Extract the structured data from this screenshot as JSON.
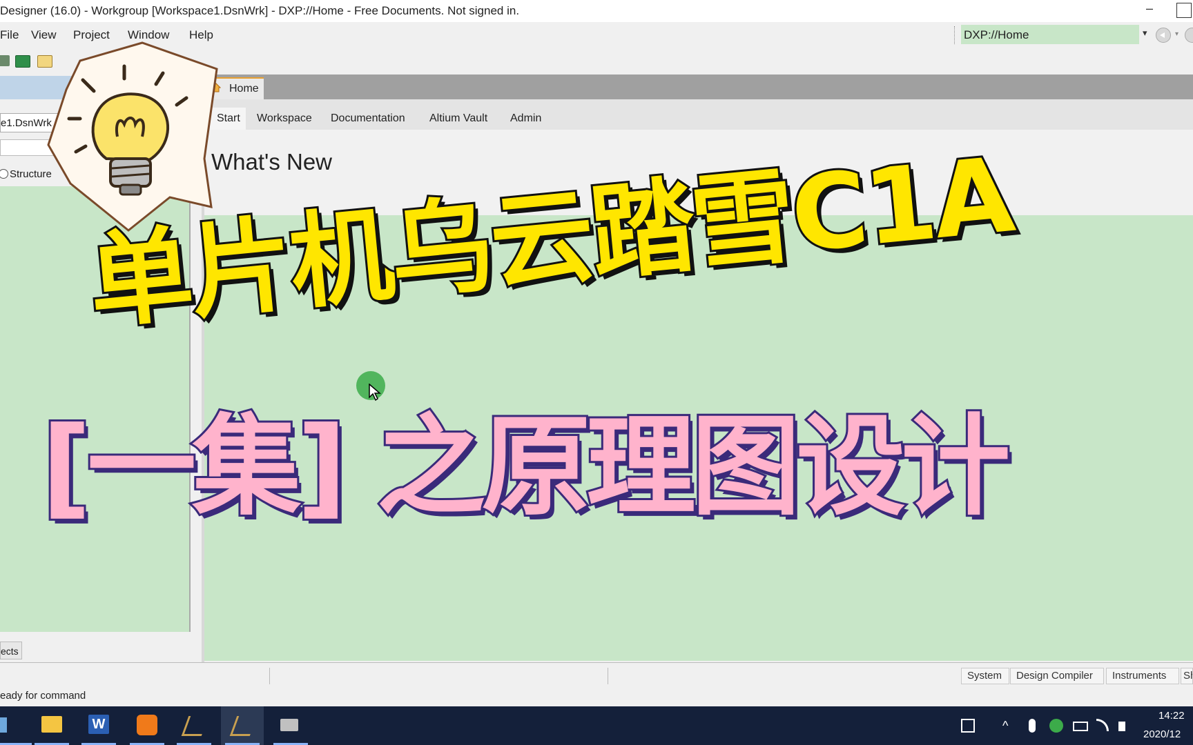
{
  "window": {
    "title": "Designer (16.0) - Workgroup [Workspace1.DsnWrk] - DXP://Home - Free Documents. Not signed in.",
    "minimize_glyph": "–"
  },
  "menu": {
    "items": [
      "File",
      "View",
      "Project",
      "Window",
      "Help"
    ]
  },
  "address": {
    "value": "DXP://Home",
    "dropdown_glyph": "▾",
    "back_dropdown_glyph": "▾"
  },
  "left_panel": {
    "workspace_name": "e1.DsnWrk",
    "structure_label": "Structure",
    "bottom_tab": "ects"
  },
  "document": {
    "tab_label": "Home",
    "nav_links": [
      "Start",
      "Workspace",
      "Documentation",
      "Altium Vault",
      "Admin"
    ],
    "heading": "What's New"
  },
  "panels": {
    "tabs": [
      "System",
      "Design Compiler",
      "Instruments",
      "Sh"
    ]
  },
  "status_text": "eady for command",
  "taskbar": {
    "clock_time": "14:22",
    "clock_date": "2020/12",
    "tray_icons": [
      "input-method-icon",
      "chevron-up-icon",
      "microphone-icon",
      "green-app-icon",
      "battery-icon",
      "wifi-icon",
      "speaker-icon"
    ]
  },
  "overlay": {
    "line1": "单片机乌云踏雪C1A",
    "line2": "[一集] 之原理图设计",
    "line1_color": "#ffe600",
    "line2_color": "#ffb3cc",
    "icon": "lightbulb-icon"
  },
  "colors": {
    "panel_green": "#c8e6c8",
    "taskbar": "#14203a",
    "address_green": "#c8e6c8"
  }
}
